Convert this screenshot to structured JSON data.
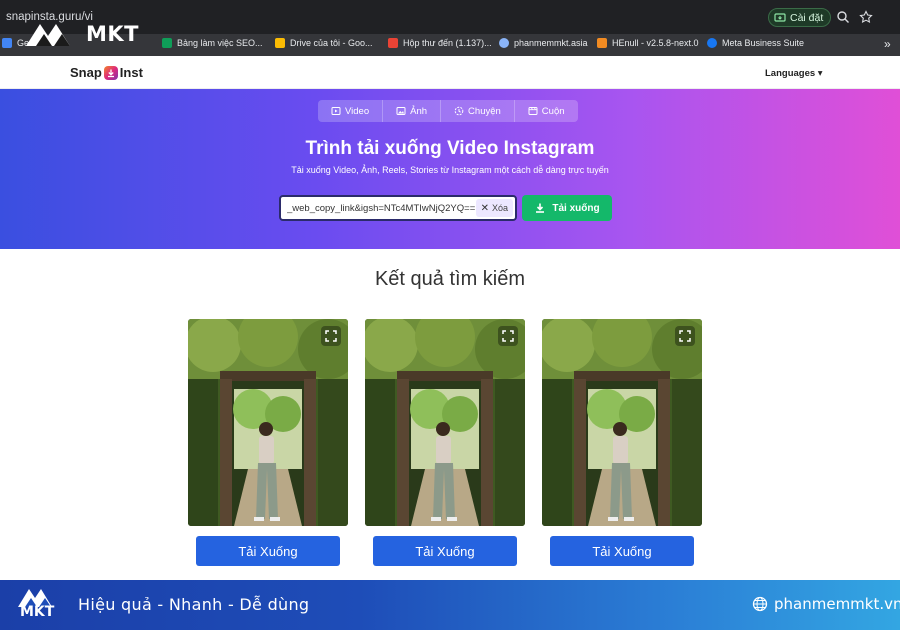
{
  "browser": {
    "url": "snapinsta.guru/vi",
    "install_label": "Cài đặt",
    "bookmarks": [
      {
        "label": "Ger",
        "color": "#4285f4"
      },
      {
        "label": "Bảng làm việc SEO...",
        "color": "#0f9d58"
      },
      {
        "label": "Drive của tôi - Goo...",
        "color": "#fbbc04"
      },
      {
        "label": "Hộp thư đến (1.137)...",
        "color": "#ea4335"
      },
      {
        "label": "phanmemmkt.asia",
        "color": "#8ab4f8"
      },
      {
        "label": "HEnull - v2.5.8-next.0",
        "color": "#f28b22"
      },
      {
        "label": "Meta Business Suite",
        "color": "#1877f2"
      }
    ],
    "more_label": "»"
  },
  "watermark": {
    "brand": "MKT"
  },
  "header": {
    "logo_left": "Snap",
    "logo_right": "Inst",
    "languages_label": "Languages ▾"
  },
  "hero": {
    "tabs": [
      {
        "label": "Video",
        "icon": "video-icon"
      },
      {
        "label": "Ảnh",
        "icon": "image-icon"
      },
      {
        "label": "Chuyện",
        "icon": "story-icon"
      },
      {
        "label": "Cuộn",
        "icon": "reel-icon"
      }
    ],
    "title": "Trình tải xuống Video Instagram",
    "subtitle": "Tải xuống Video, Ảnh, Reels, Stories từ Instagram một cách dễ dàng trực tuyến",
    "input_value": "_web_copy_link&igsh=NTc4MTIwNjQ2YQ==",
    "clear_label": "Xóa",
    "download_label": "Tải xuống"
  },
  "results": {
    "title": "Kết quả tìm kiếm",
    "items": [
      {
        "button_label": "Tải Xuống"
      },
      {
        "button_label": "Tải Xuống"
      },
      {
        "button_label": "Tải Xuống"
      }
    ]
  },
  "footer": {
    "logo_text": "MKT",
    "slogan": "Hiệu quả - Nhanh  - Dễ dùng",
    "site": "phanmemmkt.vn"
  },
  "colors": {
    "hero_start": "#3a4fe0",
    "hero_end": "#e04fd7",
    "download_green": "#14b86a",
    "card_button_blue": "#2563e0",
    "footer_blue": "#1e4db8"
  }
}
